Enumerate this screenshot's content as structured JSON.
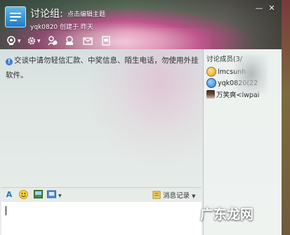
{
  "header": {
    "title": "讨论组:",
    "title_hint": "点击编辑主题",
    "subtitle": "yqk0820 创建于 昨天",
    "window_controls": {
      "minimize": "—",
      "close": "✕"
    }
  },
  "toolbar": {
    "icons": [
      "webcam-icon",
      "settings-icon",
      "add-member-icon",
      "meeting-icon",
      "mail-icon",
      "file-icon"
    ]
  },
  "chat": {
    "notice": "交谈中请勿轻信汇款、中奖信息、陌生电话，勿使用外挂软件。"
  },
  "members": {
    "header": "讨论成员(3/",
    "list": [
      {
        "name": "lmcsunh",
        "icon": "qq-member-icon"
      },
      {
        "name": "yqk0820(22",
        "icon": "qq-member-icon"
      },
      {
        "name": "万笑爽<lwpai",
        "icon": "user-photo-icon"
      }
    ]
  },
  "input_toolbar": {
    "history_label": "消息记录",
    "icons": [
      "font-icon",
      "emoji-icon",
      "image-icon",
      "screenshot-icon"
    ]
  },
  "watermark": "广东龙网",
  "colors": {
    "accent": "#3d7fd0",
    "header_pink": "#c95592"
  }
}
